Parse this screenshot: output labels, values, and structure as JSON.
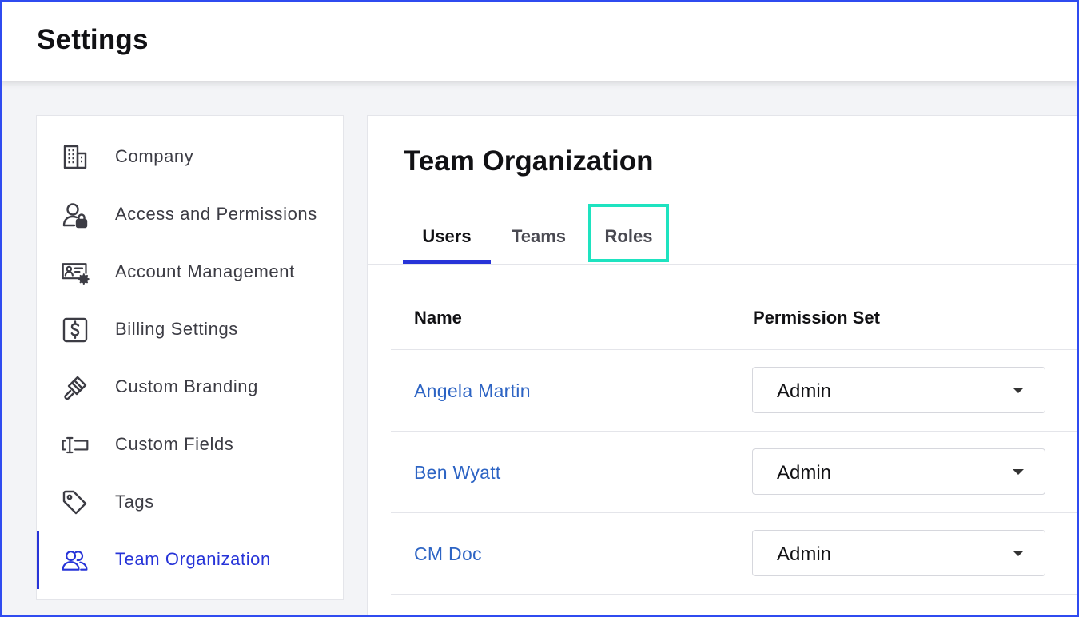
{
  "header": {
    "title": "Settings"
  },
  "sidebar": {
    "items": [
      {
        "label": "Company",
        "icon": "building-icon"
      },
      {
        "label": "Access and Permissions",
        "icon": "user-lock-icon"
      },
      {
        "label": "Account Management",
        "icon": "id-card-gear-icon"
      },
      {
        "label": "Billing Settings",
        "icon": "dollar-box-icon"
      },
      {
        "label": "Custom Branding",
        "icon": "paint-brush-icon"
      },
      {
        "label": "Custom Fields",
        "icon": "text-field-icon"
      },
      {
        "label": "Tags",
        "icon": "tag-icon"
      },
      {
        "label": "Team Organization",
        "icon": "users-icon",
        "active": true
      }
    ]
  },
  "main": {
    "heading": "Team Organization",
    "tabs": [
      {
        "label": "Users",
        "active": true
      },
      {
        "label": "Teams"
      },
      {
        "label": "Roles",
        "highlighted": true
      }
    ],
    "table": {
      "columns": [
        "Name",
        "Permission Set"
      ],
      "rows": [
        {
          "name": "Angela Martin",
          "permission_set": "Admin"
        },
        {
          "name": "Ben Wyatt",
          "permission_set": "Admin"
        },
        {
          "name": "CM Doc",
          "permission_set": "Admin"
        }
      ]
    }
  },
  "colors": {
    "accent": "#2734d8",
    "link": "#2d64c4",
    "highlight": "#1ee3c0",
    "frame": "#2f4bf0"
  }
}
